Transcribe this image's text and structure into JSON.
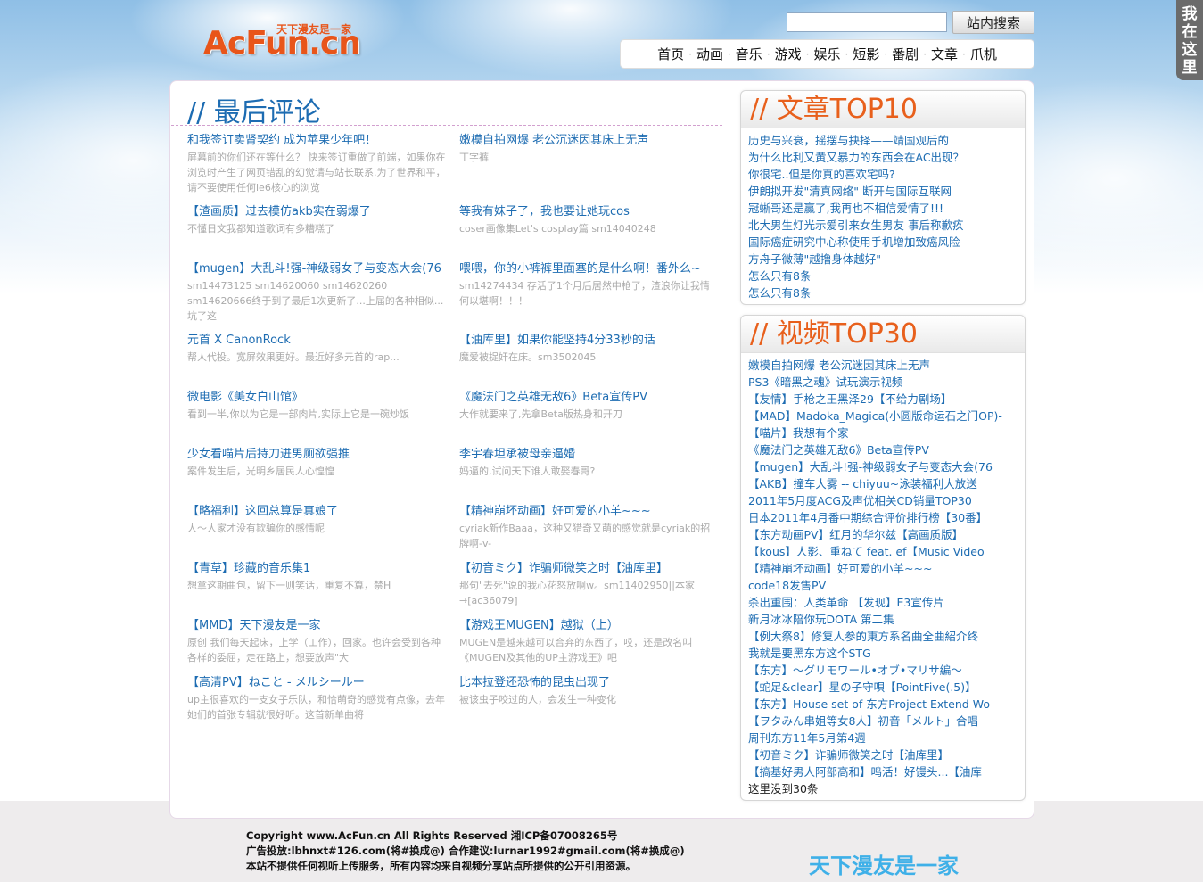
{
  "header": {
    "logo_text": "AcFun.cn",
    "logo_tagline": "天下漫友是一家",
    "search_placeholder": "",
    "search_button": "站内搜索",
    "side_tab": [
      "我",
      "在",
      "这",
      "里"
    ]
  },
  "nav": {
    "items": [
      "首页",
      "动画",
      "音乐",
      "游戏",
      "娱乐",
      "短影",
      "番剧",
      "文章",
      "爪机"
    ]
  },
  "latest": {
    "title": "// 最后评论",
    "comments": [
      {
        "title": "和我签订卖肾契约 成为苹果少年吧！",
        "body": "屏幕前的你们还在等什么？ 快来签订重做了前端，如果你在浏览时产生了网页错乱的幻觉请与站长联系.为了世界和平，请不要使用任何ie6核心的浏览"
      },
      {
        "title": "嫩模自拍网爆 老公沉迷因其床上无声",
        "body": "丁字裤"
      },
      {
        "title": "【渣画质】过去模仿akb实在弱爆了",
        "body": "不懂日文我都知道歌词有多糟糕了"
      },
      {
        "title": "等我有妹子了，我也要让她玩cos",
        "body": "coser画像集Let's cosplay篇 sm14040248"
      },
      {
        "title": "【mugen】大乱斗!强-神级弱女子与变态大会(76",
        "body": "sm14473125 sm14620060 sm14620260 sm14620666终于到了最后1次更新了...上届的各种相似...坑了这"
      },
      {
        "title": "喂喂，你的小裤裤里面塞的是什么啊！番外么~",
        "body": "sm14274434 存活了1个月后居然中枪了，渣浪你让我情何以堪啊！！！"
      },
      {
        "title": "元首 X CanonRock",
        "body": "帮人代投。宽屏效果更好。最近好多元首的rap..."
      },
      {
        "title": "【油库里】如果你能坚持4分33秒的话",
        "body": "魔爱被捉奸在床。sm3502045"
      },
      {
        "title": "微电影《美女白山馆》",
        "body": "看到一半,你以为它是一部肉片,实际上它是一碗炒饭"
      },
      {
        "title": "《魔法门之英雄无敌6》Beta宣传PV",
        "body": "大作就要来了,先拿Beta版热身和开刀"
      },
      {
        "title": "少女看喵片后持刀进男厕欲强推",
        "body": "案件发生后，光明乡居民人心惶惶"
      },
      {
        "title": "李宇春坦承被母亲逼婚",
        "body": "妈逼的,试问天下谁人敢娶春哥?"
      },
      {
        "title": "【略福利】这回总算是真娘了",
        "body": "人～人家才没有欺骗你的感情呢"
      },
      {
        "title": "【精神崩坏动画】好可爱的小羊~~~",
        "body": "cyriak新作Baaa，这种又猎奇又萌的感觉就是cyriak的招牌啊-v-"
      },
      {
        "title": "【青草】珍藏的音乐集1",
        "body": "想拿这期曲包，留下一则笑话，重复不算，禁H"
      },
      {
        "title": "【初音ミク】诈骗师微笑之时【油库里】",
        "body": "那句\"去死\"说的我心花怒放啊w。sm11402950||本家→[ac36079]"
      },
      {
        "title": "【MMD】天下漫友是一家",
        "body": "原创 我们每天起床，上学（工作），回家。也许会受到各种各样的委屈，走在路上，想要放声\"大"
      },
      {
        "title": "【游戏王MUGEN】越狱（上）",
        "body": "MUGEN是越来越可以合弃的东西了，哎，还是改名叫 《MUGEN及其他的UP主游戏王》吧"
      },
      {
        "title": "【高清PV】ねこと - メルシールー",
        "body": "up主很喜欢的一支女子乐队，和恰萌奇的感觉有点像，去年她们的首张专辑就很好听。这首新单曲将"
      },
      {
        "title": "比本拉登还恐怖的昆虫出现了",
        "body": "被该虫子咬过的人，会发生一种变化"
      }
    ]
  },
  "articles_top10": {
    "title": "// 文章TOP10",
    "items": [
      "历史与兴衰，摇摆与抉择——靖国观后的",
      "为什么比利又黄又暴力的东西会在AC出现？",
      "你很宅..但是你真的喜欢宅吗?",
      "伊朗拟开发\"清真网络\" 断开与国际互联网",
      "冠蜥哥还是赢了,我再也不相信爱情了!!!",
      "北大男生灯光示爱引来女生男友 事后称歉疚",
      "国际癌症研究中心称使用手机增加致癌风险",
      "方舟子微薄\"越撸身体越好\"",
      "怎么只有8条",
      "怎么只有8条"
    ]
  },
  "videos_top30": {
    "title": "// 视频TOP30",
    "items": [
      "嫩模自拍网爆 老公沉迷因其床上无声",
      "PS3《暗黑之魂》试玩演示视频",
      "【友情】手枪之王黑泽29【不给力剧场】",
      "【MAD】Madoka_Magica(小圆版命运石之门OP)-",
      "【喵片】我想有个家",
      "《魔法门之英雄无敌6》Beta宣传PV",
      "【mugen】大乱斗!强-神级弱女子与变态大会(76",
      "【AKB】撞车大雾 -- chiyuu~泳装福利大放送",
      "2011年5月度ACG及声优相关CD销量TOP30",
      "日本2011年4月番中期综合评价排行榜【30番】",
      "【东方动画PV】红月的华尔兹【高画质版】",
      "【kous】人影、重ねて feat. ef【Music Video",
      "【精神崩坏动画】好可爱的小羊~~~",
      "code18发售PV",
      "杀出重围：人类革命 【发现】E3宣传片",
      "新月冰冰陪你玩DOTA 第二集",
      "【例大祭8】修复人参的東方系名曲全曲紹介终",
      "我就是要黑东方这个STG",
      "【东方】～グリモワール•オブ•マリサ編～",
      "【蛇足&clear】星の子守唄【PointFive(.5)】",
      "【东方】House set of 东方Project Extend Wo",
      "【ヲタみん串姐等女8人】初音「メルト」合唱",
      "周刊东方11年5月第4週",
      "【初音ミク】诈骗师微笑之时【油库里】",
      "【搞基好男人阿部高和】鸣活！好馒头...【油库"
    ],
    "footer_note": "这里没到30条"
  },
  "footer": {
    "line1": "Copyright www.AcFun.cn All Rights Reserved 湘ICP备07008265号",
    "line2": "广告投放:lbhnxt#126.com(将#换成@) 合作建议:lurnar1992#gmail.com(将#换成@)",
    "line3": "本站不提供任何视听上传服务，所有内容均来自视频分享站点所提供的公开引用资源。",
    "slogan": "天下漫友是一家"
  }
}
